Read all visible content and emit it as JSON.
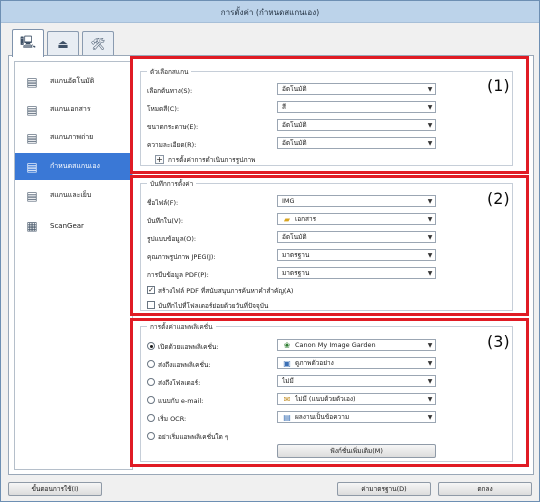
{
  "window": {
    "title": "การตั้งค่า (กำหนดสแกนเอง)"
  },
  "tabs": [
    {
      "icon": "scan-computer-icon",
      "glyph": "🖳"
    },
    {
      "icon": "scanner-icon",
      "glyph": "⏏"
    },
    {
      "icon": "tools-icon",
      "glyph": "🛠"
    }
  ],
  "sidebar": {
    "items": [
      {
        "label": "สแกนอัตโนมัติ",
        "glyph": "▤"
      },
      {
        "label": "สแกนเอกสาร",
        "glyph": "▤"
      },
      {
        "label": "สแกนภาพถ่าย",
        "glyph": "▤"
      },
      {
        "label": "กำหนดสแกนเอง",
        "glyph": "▤"
      },
      {
        "label": "สแกนและเย็บ",
        "glyph": "▤"
      },
      {
        "label": "ScanGear",
        "glyph": "▦"
      }
    ]
  },
  "section1": {
    "title": "ตัวเลือกสแกน",
    "rows": [
      {
        "label": "เลือกต้นทาง(S):",
        "value": "อัตโนมัติ"
      },
      {
        "label": "โหมดสี(C):",
        "value": "สี"
      },
      {
        "label": "ขนาดกระดาษ(E):",
        "value": "อัตโนมัติ"
      },
      {
        "label": "ความละเอียด(R):",
        "value": "อัตโนมัติ"
      }
    ],
    "expander": "การตั้งค่าการดำเนินการรูปภาพ",
    "number": "(1)"
  },
  "section2": {
    "title": "บันทึกการตั้งค่า",
    "rows": [
      {
        "label": "ชื่อไฟล์(F):",
        "value": "IMG"
      },
      {
        "label": "บันทึกใน(V):",
        "value": "เอกสาร"
      },
      {
        "label": "รูปแบบข้อมูล(O):",
        "value": "อัตโนมัติ"
      },
      {
        "label": "คุณภาพรูปภาพ JPEG(J):",
        "value": "มาตรฐาน"
      },
      {
        "label": "การบีบข้อมูล PDF(P):",
        "value": "มาตรฐาน"
      }
    ],
    "checks": [
      {
        "label": "สร้างไฟล์ PDF ที่สนับสนุนการค้นหาคำสำคัญ(A)",
        "checked": true
      },
      {
        "label": "บันทึกไปที่โฟลเดอร์ย่อยด้วยวันที่ปัจจุบัน",
        "checked": false
      }
    ],
    "number": "(2)"
  },
  "section3": {
    "title": "การตั้งค่าแอพพลิเคชั่น",
    "rows": [
      {
        "label": "เปิดด้วยแอพพลิเคชั่น:",
        "value": "Canon My Image Garden",
        "selected": true
      },
      {
        "label": "ส่งถึงแอพพลิเคชั่น:",
        "value": "ดูภาพตัวอย่าง",
        "selected": false
      },
      {
        "label": "ส่งถึงโฟลเดอร์:",
        "value": "ไม่มี",
        "selected": false
      },
      {
        "label": "แนบกับ e-mail:",
        "value": "ไม่มี (แนบด้วยตัวเอง)",
        "selected": false
      },
      {
        "label": "เริ่ม OCR:",
        "value": "ผลงานเป็นข้อความ",
        "selected": false
      }
    ],
    "noapp": "อย่าเริ่มแอพพลิเคชั่นใด ๆ",
    "more_button": "ฟังก์ชั่นเพิ่มเติม(M)",
    "number": "(3)"
  },
  "footer": {
    "instructions": "ขั้นตอนการใช้(I)",
    "defaults": "ค่ามาตรฐาน(D)",
    "ok": "ตกลง"
  }
}
